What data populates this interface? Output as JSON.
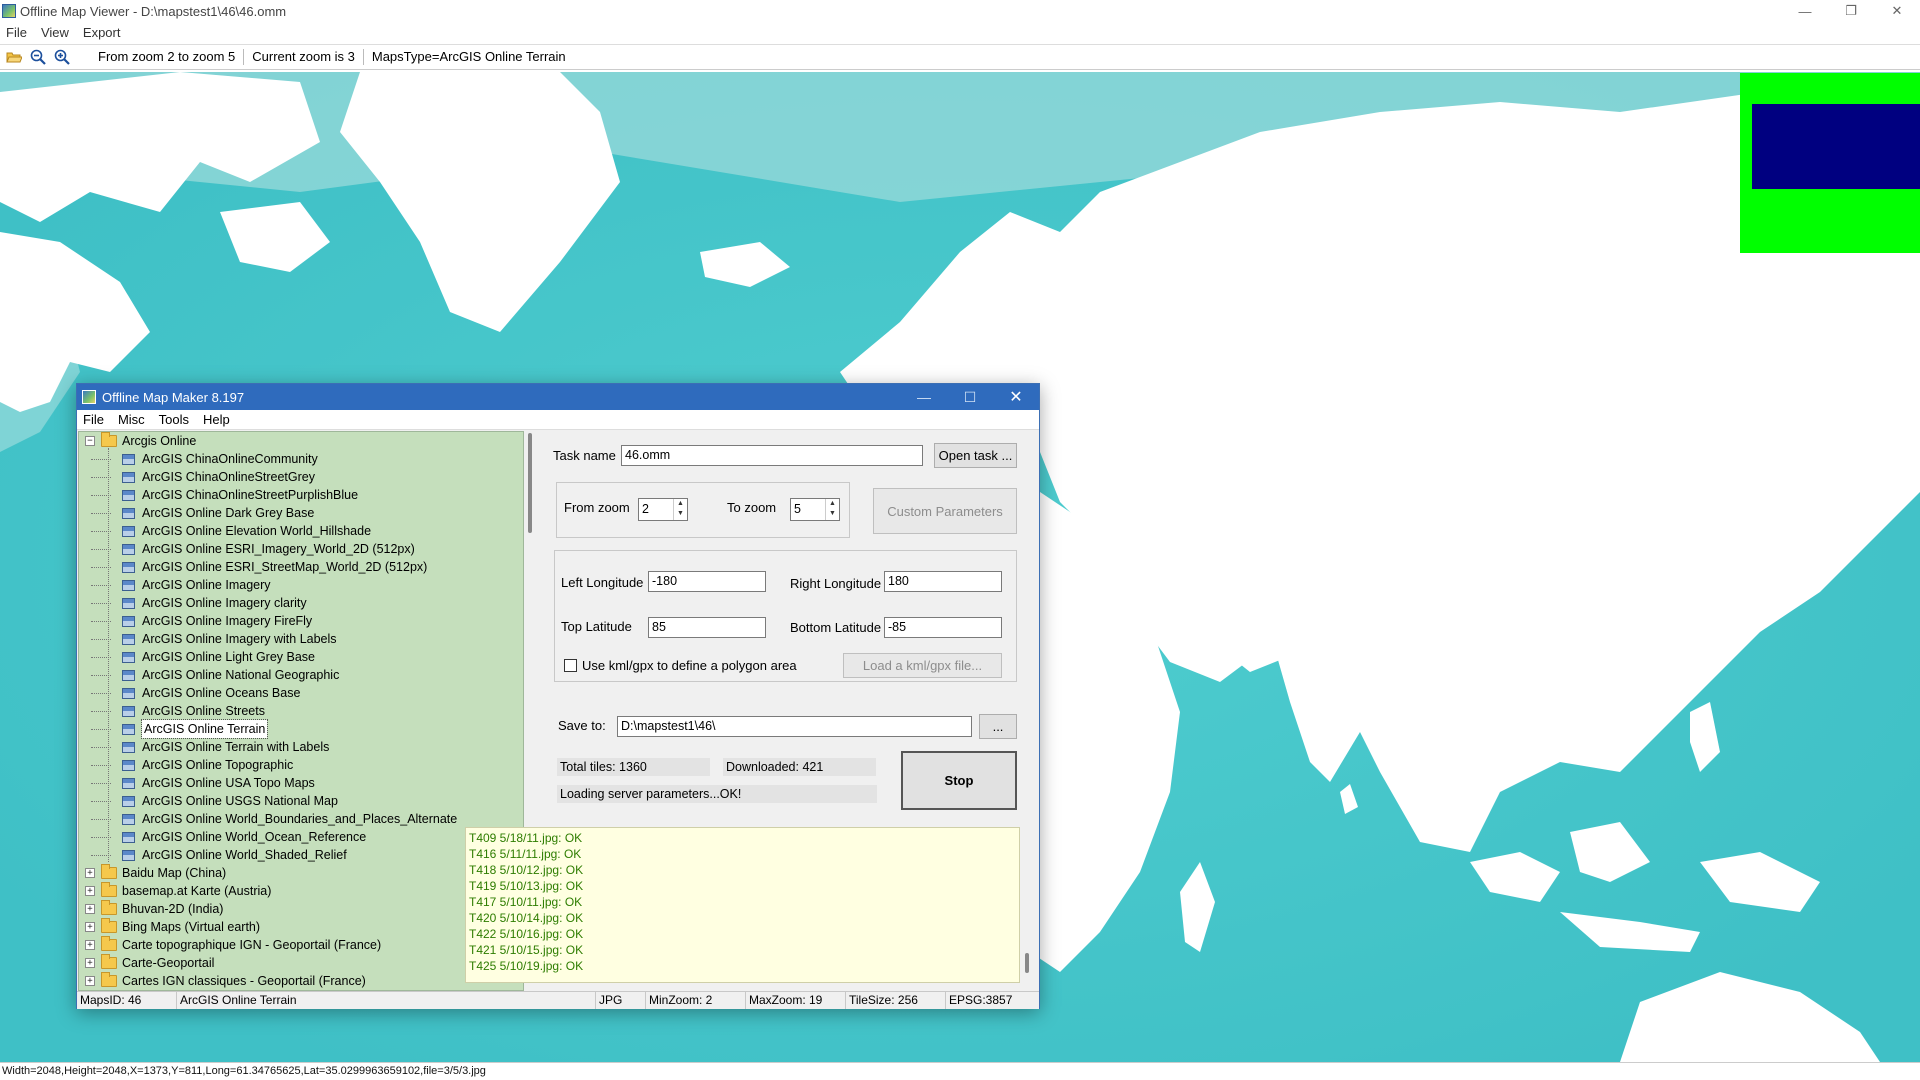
{
  "app": {
    "title": "Offline Map Viewer - D:\\mapstest1\\46\\46.omm",
    "menu": [
      "File",
      "View",
      "Export"
    ],
    "window_buttons": {
      "minimize": "—",
      "restore": "❐",
      "close": "✕"
    }
  },
  "toolbar": {
    "zoom_range": "From zoom 2 to zoom 5",
    "current_zoom": "Current zoom is 3",
    "maps_type": "MapsType=ArcGIS Online Terrain"
  },
  "colors": {
    "ocean": "#4ecbcc",
    "land": "#ffffff",
    "overview_bg": "#00ff00",
    "overview_viewport": "#000080",
    "tree_bg": "#c5dfbc",
    "log_bg": "#ffffe1",
    "log_text": "#2e7d00"
  },
  "statusbar": {
    "text": "Width=2048,Height=2048,X=1373,Y=811,Long=61.34765625,Lat=35.0299963659102,file=3/5/3.jpg"
  },
  "dialog": {
    "title": "Offline Map Maker 8.197",
    "menu": [
      "File",
      "Misc",
      "Tools",
      "Help"
    ],
    "window_buttons": {
      "minimize": "—",
      "maximize": "☐",
      "close": "✕"
    },
    "tree": {
      "root": "Arcgis Online",
      "children": [
        "ArcGIS ChinaOnlineCommunity",
        "ArcGIS ChinaOnlineStreetGrey",
        "ArcGIS ChinaOnlineStreetPurplishBlue",
        "ArcGIS Online Dark Grey Base",
        "ArcGIS Online Elevation World_Hillshade",
        "ArcGIS Online ESRI_Imagery_World_2D (512px)",
        "ArcGIS Online ESRI_StreetMap_World_2D (512px)",
        "ArcGIS Online Imagery",
        "ArcGIS Online Imagery clarity",
        "ArcGIS Online Imagery FireFly",
        "ArcGIS Online Imagery with Labels",
        "ArcGIS Online Light Grey Base",
        "ArcGIS Online National Geographic",
        "ArcGIS Online Oceans Base",
        "ArcGIS Online Streets",
        "ArcGIS Online Terrain",
        "ArcGIS Online Terrain with Labels",
        "ArcGIS Online Topographic",
        "ArcGIS Online USA Topo Maps",
        "ArcGIS Online USGS National Map",
        "ArcGIS Online World_Boundaries_and_Places_Alternate",
        "ArcGIS Online World_Ocean_Reference",
        "ArcGIS Online World_Shaded_Relief"
      ],
      "selected": "ArcGIS Online Terrain",
      "collapsed_roots": [
        "Baidu Map (China)",
        "basemap.at Karte (Austria)",
        "Bhuvan-2D (India)",
        "Bing Maps (Virtual earth)",
        "Carte topographique IGN - Geoportail (France)",
        "Carte-Geoportail",
        "Cartes IGN classiques - Geoportail (France)"
      ]
    },
    "form": {
      "task_name_label": "Task name",
      "task_name_value": "46.omm",
      "open_task_button": "Open task ...",
      "from_zoom_label": "From zoom",
      "from_zoom_value": "2",
      "to_zoom_label": "To zoom",
      "to_zoom_value": "5",
      "custom_params_button": "Custom Parameters",
      "left_lon_label": "Left Longitude",
      "left_lon_value": "-180",
      "right_lon_label": "Right Longitude",
      "right_lon_value": "180",
      "top_lat_label": "Top Latitude",
      "top_lat_value": "85",
      "bottom_lat_label": "Bottom Latitude",
      "bottom_lat_value": "-85",
      "kml_checkbox_label": "Use kml/gpx to define a polygon area",
      "kml_checked": false,
      "load_kml_button": "Load a kml/gpx file...",
      "save_to_label": "Save to:",
      "save_to_value": "D:\\mapstest1\\46\\",
      "browse_button": "...",
      "total_tiles": "Total tiles: 1360",
      "downloaded": "Downloaded: 421",
      "status_message": "Loading server parameters...OK!",
      "stop_button": "Stop"
    },
    "log": [
      "T409 5/18/11.jpg: OK",
      "T416 5/11/11.jpg: OK",
      "T418 5/10/12.jpg: OK",
      "T419 5/10/13.jpg: OK",
      "T417 5/10/11.jpg: OK",
      "T420 5/10/14.jpg: OK",
      "T422 5/10/16.jpg: OK",
      "T421 5/10/15.jpg: OK",
      "T425 5/10/19.jpg: OK"
    ],
    "status": {
      "maps_id": "MapsID: 46",
      "map_name": "ArcGIS Online Terrain",
      "format": "JPG",
      "min_zoom": "MinZoom: 2",
      "max_zoom": "MaxZoom: 19",
      "tile_size": "TileSize: 256",
      "epsg": "EPSG:3857"
    }
  }
}
